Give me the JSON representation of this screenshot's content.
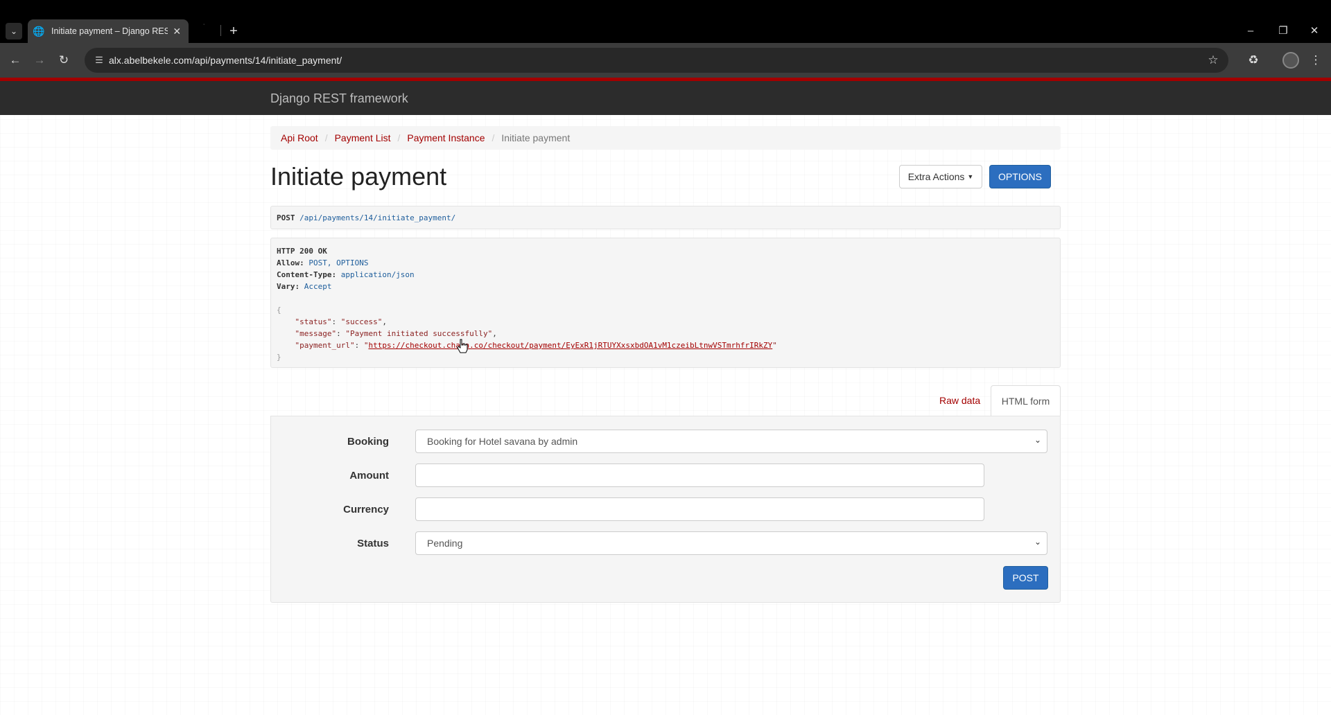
{
  "browser": {
    "tab_title": "Initiate payment – Django REST framework",
    "url": "alx.abelbekele.com/api/payments/14/initiate_payment/"
  },
  "navbar": {
    "brand": "Django REST framework"
  },
  "breadcrumb": [
    "Api Root",
    "Payment List",
    "Payment Instance",
    "Initiate payment"
  ],
  "page": {
    "title": "Initiate payment",
    "extra_actions_label": "Extra Actions",
    "options_label": "OPTIONS"
  },
  "request": {
    "method": "POST",
    "path": "/api/payments/14/initiate_payment/"
  },
  "response": {
    "status_line": "HTTP 200 OK",
    "allow_key": "Allow:",
    "allow_value": "POST, OPTIONS",
    "content_type_key": "Content-Type:",
    "content_type_value": "application/json",
    "vary_key": "Vary:",
    "vary_value": "Accept",
    "open_brace": "{",
    "close_brace": "}",
    "status_key": "\"status\"",
    "status_value": "\"success\"",
    "message_key": "\"message\"",
    "message_value": "\"Payment initiated successfully\"",
    "payment_url_key": "\"payment_url\"",
    "payment_url_value": "https://checkout.chapa.co/checkout/payment/EyExR1jRTUYXxsxbdOA1vM1czeibLtnwVSTmrhfrIRkZY"
  },
  "tabs": {
    "raw": "Raw data",
    "html": "HTML form"
  },
  "form": {
    "booking_label": "Booking",
    "booking_value": "Booking for Hotel savana by admin",
    "amount_label": "Amount",
    "amount_value": "",
    "currency_label": "Currency",
    "currency_value": "",
    "status_label": "Status",
    "status_value": "Pending",
    "post_label": "POST"
  }
}
